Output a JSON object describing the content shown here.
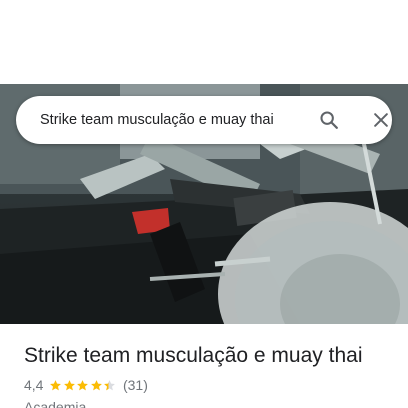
{
  "search": {
    "query": "Strike team musculação e muay thai"
  },
  "place": {
    "title": "Strike team musculação e muay thai",
    "rating": "4,4",
    "rating_fraction": 0.88,
    "review_count": "(31)",
    "category": "Academia"
  },
  "icons": {
    "search": "search-icon",
    "close": "close-icon",
    "star": "star-icon"
  },
  "colors": {
    "star": "#fbbc04",
    "secondary_text": "#70757a",
    "primary_text": "#202124"
  }
}
